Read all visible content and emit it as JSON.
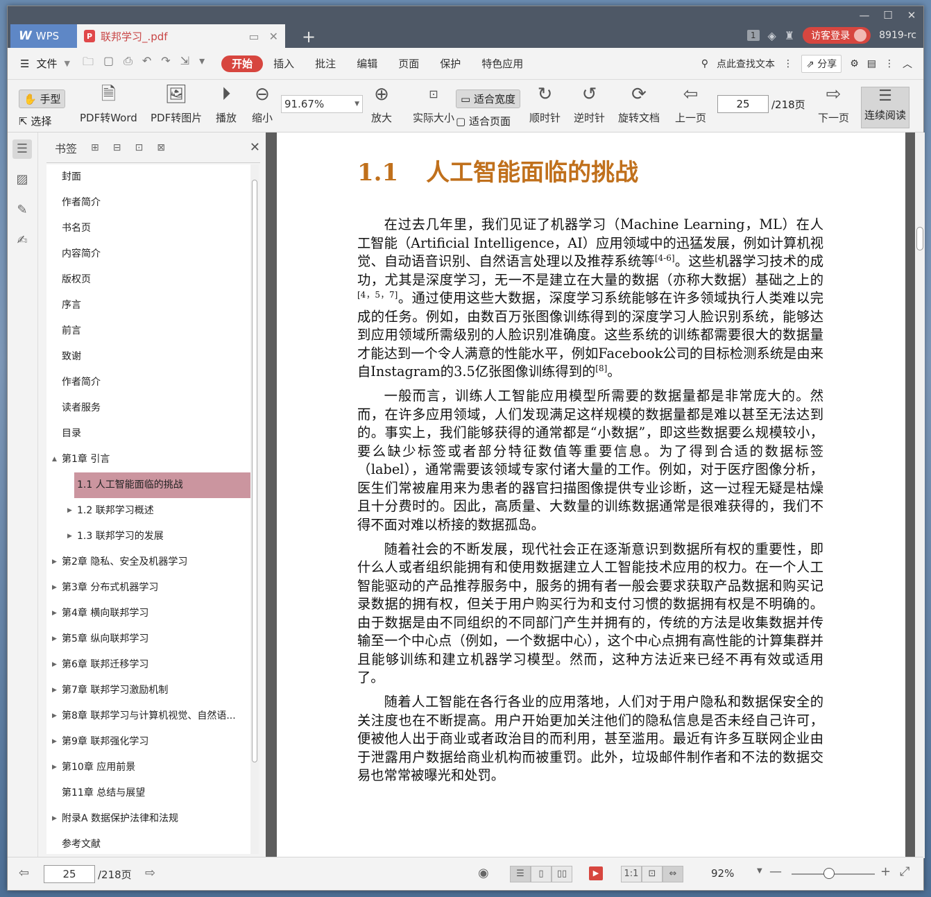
{
  "titlebar": {
    "app_name": "WPS",
    "doc_tab_title": "联邦学习_.pdf",
    "page_badge": "1",
    "login_label": "访客登录",
    "version": "8919-rc"
  },
  "menubar": {
    "file_label": "文件",
    "tabs": [
      "开始",
      "插入",
      "批注",
      "编辑",
      "页面",
      "保护",
      "特色应用"
    ],
    "search_label": "点此查找文本",
    "share_label": "分享"
  },
  "toolbar": {
    "hand_label": "手型",
    "select_label": "选择",
    "pdf_to_word": "PDF转Word",
    "pdf_to_image": "PDF转图片",
    "play": "播放",
    "zoom_out": "缩小",
    "zoom_value": "91.67%",
    "zoom_in": "放大",
    "actual_size": "实际大小",
    "fit_width": "适合宽度",
    "fit_page": "适合页面",
    "clockwise": "顺时针",
    "counter_clockwise": "逆时针",
    "rotate_doc": "旋转文档",
    "prev_page": "上一页",
    "page_value": "25",
    "page_total": "/218页",
    "next_page": "下一页",
    "continuous_read": "连续阅读"
  },
  "bookmarks": {
    "title": "书签",
    "items": [
      {
        "label": "封面",
        "level": 1,
        "toggle": ""
      },
      {
        "label": "作者简介",
        "level": 1,
        "toggle": ""
      },
      {
        "label": "书名页",
        "level": 1,
        "toggle": ""
      },
      {
        "label": "内容简介",
        "level": 1,
        "toggle": ""
      },
      {
        "label": "版权页",
        "level": 1,
        "toggle": ""
      },
      {
        "label": "序言",
        "level": 1,
        "toggle": ""
      },
      {
        "label": "前言",
        "level": 1,
        "toggle": ""
      },
      {
        "label": "致谢",
        "level": 1,
        "toggle": ""
      },
      {
        "label": "作者简介",
        "level": 1,
        "toggle": ""
      },
      {
        "label": "读者服务",
        "level": 1,
        "toggle": ""
      },
      {
        "label": "目录",
        "level": 1,
        "toggle": ""
      },
      {
        "label": "第1章 引言",
        "level": 1,
        "toggle": "▲"
      },
      {
        "label": "1.1 人工智能面临的挑战",
        "level": 2,
        "toggle": "",
        "active": true
      },
      {
        "label": "1.2 联邦学习概述",
        "level": 2,
        "toggle": "▶"
      },
      {
        "label": "1.3 联邦学习的发展",
        "level": 2,
        "toggle": "▶"
      },
      {
        "label": "第2章 隐私、安全及机器学习",
        "level": 1,
        "toggle": "▶"
      },
      {
        "label": "第3章 分布式机器学习",
        "level": 1,
        "toggle": "▶"
      },
      {
        "label": "第4章 横向联邦学习",
        "level": 1,
        "toggle": "▶"
      },
      {
        "label": "第5章 纵向联邦学习",
        "level": 1,
        "toggle": "▶"
      },
      {
        "label": "第6章 联邦迁移学习",
        "level": 1,
        "toggle": "▶"
      },
      {
        "label": "第7章 联邦学习激励机制",
        "level": 1,
        "toggle": "▶"
      },
      {
        "label": "第8章 联邦学习与计算机视觉、自然语...",
        "level": 1,
        "toggle": "▶"
      },
      {
        "label": "第9章 联邦强化学习",
        "level": 1,
        "toggle": "▶"
      },
      {
        "label": "第10章 应用前景",
        "level": 1,
        "toggle": "▶"
      },
      {
        "label": "第11章 总结与展望",
        "level": 1,
        "toggle": ""
      },
      {
        "label": "附录A 数据保护法律和法规",
        "level": 1,
        "toggle": "▶"
      },
      {
        "label": "参考文献",
        "level": 1,
        "toggle": ""
      }
    ]
  },
  "document": {
    "heading_num": "1.1",
    "heading_text": "人工智能面临的挑战",
    "paragraphs": [
      [
        "在过去几年里，我们见证了机器学习（Machine Learning，ML）在人工智能（Artificial Intelligence，AI）应用领域中的迅猛发展，例如计算机视觉、自动语音识别、自然语言处理以及推荐系统等",
        "[4-6]",
        "。这些机器学习技术的成功，尤其是深度学习，无一不是建立在大量的数据（亦称大数据）基础之上的",
        "[4，5，7]",
        "。通过使用这些大数据，深度学习系统能够在许多领域执行人类难以完成的任务。例如，由数百万张图像训练得到的深度学习人脸识别系统，能够达到应用领域所需级别的人脸识别准确度。这些系统的训练都需要很大的数据量才能达到一个令人满意的性能水平，例如Facebook公司的目标检测系统是由来自Instagram的3.5亿张图像训练得到的",
        "[8]",
        "。"
      ],
      [
        "一般而言，训练人工智能应用模型所需要的数据量都是非常庞大的。然而，在许多应用领域，人们发现满足这样规模的数据量都是难以甚至无法达到的。事实上，我们能够获得的通常都是“小数据”，即这些数据要么规模较小，要么缺少标签或者部分特征数值等重要信息。为了得到合适的数据标签（label），通常需要该领域专家付诸大量的工作。例如，对于医疗图像分析，医生们常被雇用来为患者的器官扫描图像提供专业诊断，这一过程无疑是枯燥且十分费时的。因此，高质量、大数量的训练数据通常是很难获得的，我们不得不面对难以桥接的数据孤岛。"
      ],
      [
        "随着社会的不断发展，现代社会正在逐渐意识到数据所有权的重要性，即什么人或者组织能拥有和使用数据建立人工智能技术应用的权力。在一个人工智能驱动的产品推荐服务中，服务的拥有者一般会要求获取产品数据和购买记录数据的拥有权，但关于用户购买行为和支付习惯的数据拥有权是不明确的。由于数据是由不同组织的不同部门产生并拥有的，传统的方法是收集数据并传输至一个中心点（例如，一个数据中心），这个中心点拥有高性能的计算集群并且能够训练和建立机器学习模型。然而，这种方法近来已经不再有效或适用了。"
      ],
      [
        "随着人工智能在各行各业的应用落地，人们对于用户隐私和数据保安全的关注度也在不断提高。用户开始更加关注他们的隐私信息是否未经自己许可，便被他人出于商业或者政治目的而利用，甚至滥用。最近有许多互联网企业由于泄露用户数据给商业机构而被重罚。此外，垃圾邮件制作者和不法的数据交易也常常被曝光和处罚。"
      ]
    ]
  },
  "statusbar": {
    "page_value": "25",
    "page_total": "/218页",
    "zoom_value": "92%",
    "zoom_fraction": 0.45
  }
}
